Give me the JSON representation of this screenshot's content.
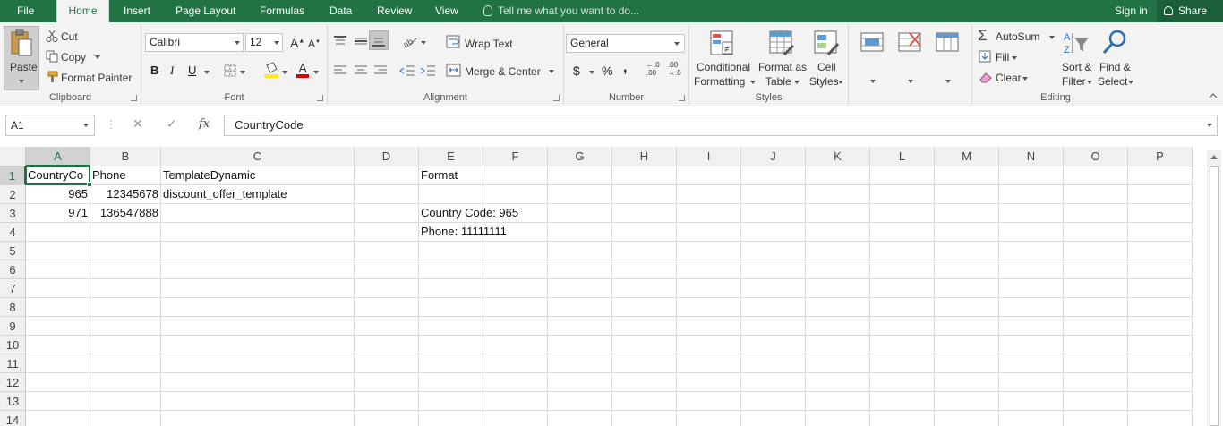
{
  "tabs": {
    "file": "File",
    "home": "Home",
    "insert": "Insert",
    "page_layout": "Page Layout",
    "formulas": "Formulas",
    "data": "Data",
    "review": "Review",
    "view": "View",
    "tell_me": "Tell me what you want to do...",
    "sign_in": "Sign in",
    "share": "Share"
  },
  "clipboard": {
    "paste": "Paste",
    "cut": "Cut",
    "copy": "Copy",
    "format_painter": "Format Painter",
    "label": "Clipboard"
  },
  "font": {
    "name": "Calibri",
    "size": "12",
    "bold": "B",
    "italic": "I",
    "underline": "U",
    "label": "Font"
  },
  "alignment": {
    "wrap_text": "Wrap Text",
    "merge_center": "Merge & Center",
    "label": "Alignment"
  },
  "number": {
    "format": "General",
    "currency": "$",
    "percent": "%",
    "comma": ",",
    "label": "Number"
  },
  "styles": {
    "conditional_1": "Conditional",
    "conditional_2": "Formatting",
    "format_table_1": "Format as",
    "format_table_2": "Table",
    "cell_styles_1": "Cell",
    "cell_styles_2": "Styles",
    "label": "Styles"
  },
  "cells": {
    "A1": "CountryCo",
    "B1": "Phone",
    "C1": "TemplateDynamic",
    "E1": "Format",
    "A2": "965",
    "B2": "12345678",
    "C2": "discount_offer_template",
    "A3": "971",
    "B3": "136547888",
    "E3": "Country Code: 965",
    "E4": "Phone: 11111111"
  },
  "editing": {
    "autosum": "AutoSum",
    "fill": "Fill",
    "clear": "Clear",
    "sort_1": "Sort &",
    "sort_2": "Filter",
    "find_1": "Find &",
    "find_2": "Select",
    "label": "Editing"
  },
  "formula_bar": {
    "name_box": "A1",
    "fx": "fx",
    "content": "CountryCode"
  },
  "colors": {
    "accent": "#217346",
    "ribbon_bg": "#f3f3f3"
  },
  "columns": [
    "A",
    "B",
    "C",
    "D",
    "E",
    "F",
    "G",
    "H",
    "I",
    "J",
    "K",
    "L",
    "M",
    "N",
    "O",
    "P"
  ],
  "rows": [
    "1",
    "2",
    "3",
    "4",
    "5",
    "6",
    "7",
    "8",
    "9",
    "10",
    "11",
    "12",
    "13",
    "14"
  ]
}
